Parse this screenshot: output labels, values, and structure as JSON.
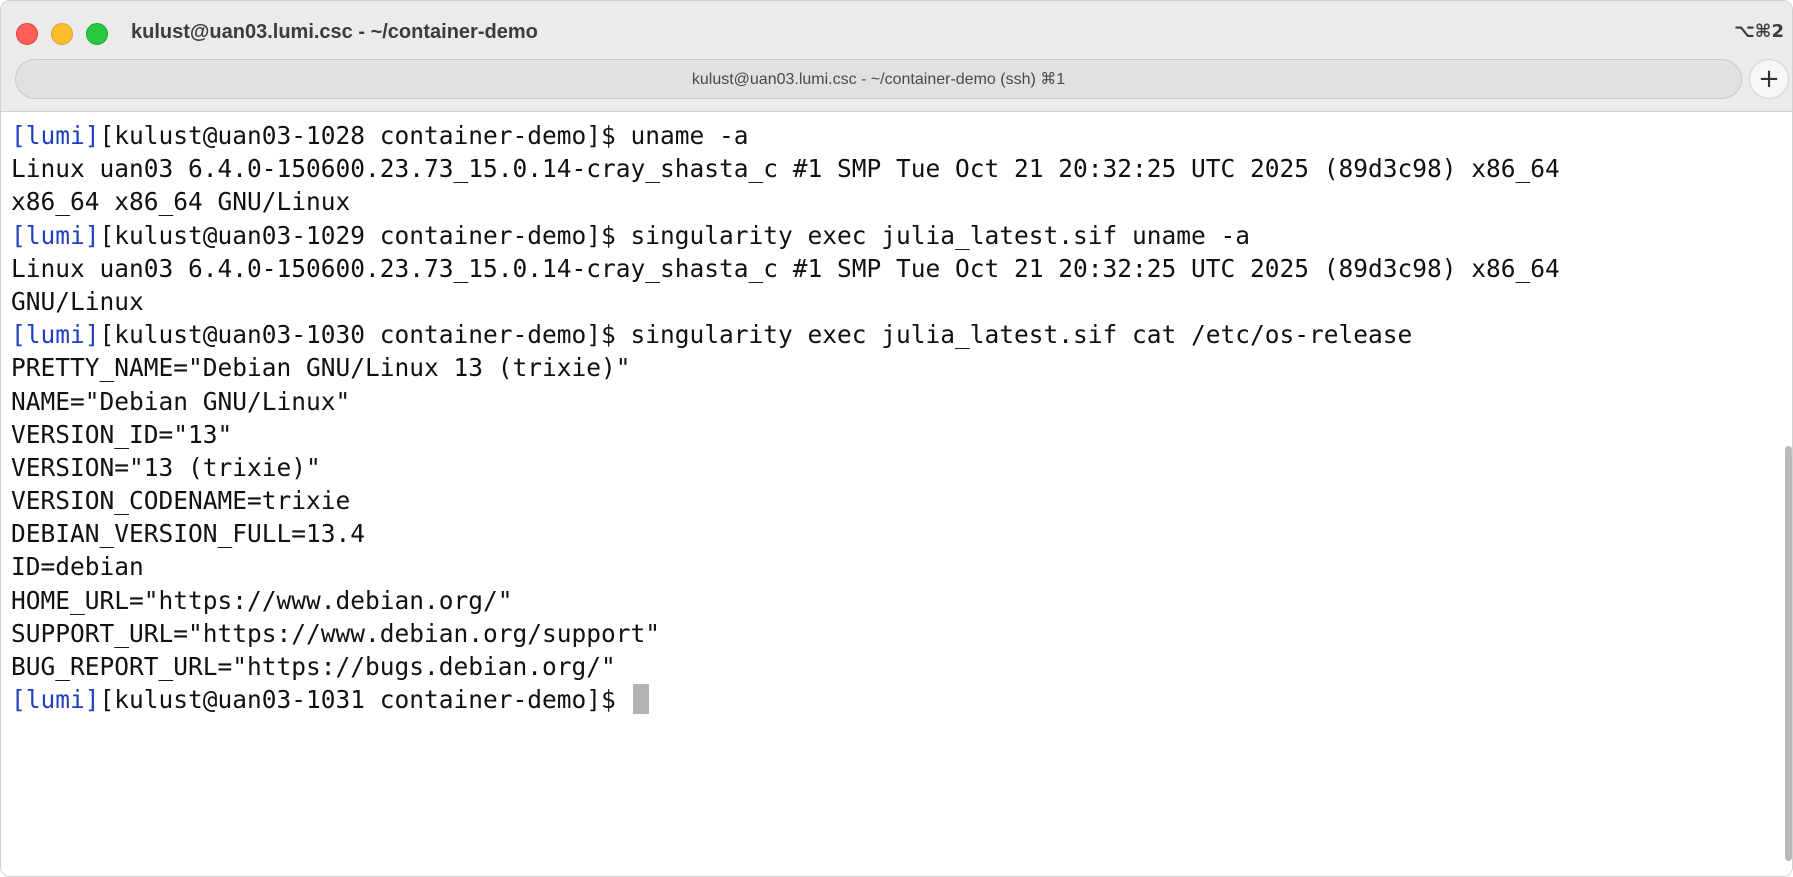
{
  "window": {
    "title": "kulust@uan03.lumi.csc - ~/container-demo",
    "shortcut": "⌥⌘2"
  },
  "tabs": [
    {
      "label": "kulust@uan03.lumi.csc - ~/container-demo (ssh) ⌘1",
      "active": true
    }
  ],
  "new_tab_label": "+",
  "colors": {
    "prompt_tag": "#1f3fbf",
    "text": "#111111",
    "close": "#ff5f57",
    "minimize": "#febc2e",
    "maximize": "#28c840"
  },
  "terminal": {
    "lines": [
      {
        "tag": "[lumi]",
        "text": "[kulust@uan03-1028 container-demo]$ uname -a"
      },
      {
        "text": "Linux uan03 6.4.0-150600.23.73_15.0.14-cray_shasta_c #1 SMP Tue Oct 21 20:32:25 UTC 2025 (89d3c98) x86_64"
      },
      {
        "text": "x86_64 x86_64 GNU/Linux"
      },
      {
        "tag": "[lumi]",
        "text": "[kulust@uan03-1029 container-demo]$ singularity exec julia_latest.sif uname -a"
      },
      {
        "text": "Linux uan03 6.4.0-150600.23.73_15.0.14-cray_shasta_c #1 SMP Tue Oct 21 20:32:25 UTC 2025 (89d3c98) x86_64"
      },
      {
        "text": "GNU/Linux"
      },
      {
        "tag": "[lumi]",
        "text": "[kulust@uan03-1030 container-demo]$ singularity exec julia_latest.sif cat /etc/os-release"
      },
      {
        "text": "PRETTY_NAME=\"Debian GNU/Linux 13 (trixie)\""
      },
      {
        "text": "NAME=\"Debian GNU/Linux\""
      },
      {
        "text": "VERSION_ID=\"13\""
      },
      {
        "text": "VERSION=\"13 (trixie)\""
      },
      {
        "text": "VERSION_CODENAME=trixie"
      },
      {
        "text": "DEBIAN_VERSION_FULL=13.4"
      },
      {
        "text": "ID=debian"
      },
      {
        "text": "HOME_URL=\"https://www.debian.org/\""
      },
      {
        "text": "SUPPORT_URL=\"https://www.debian.org/support\""
      },
      {
        "text": "BUG_REPORT_URL=\"https://bugs.debian.org/\""
      },
      {
        "tag": "[lumi]",
        "text": "[kulust@uan03-1031 container-demo]$ ",
        "cursor": true
      }
    ]
  }
}
